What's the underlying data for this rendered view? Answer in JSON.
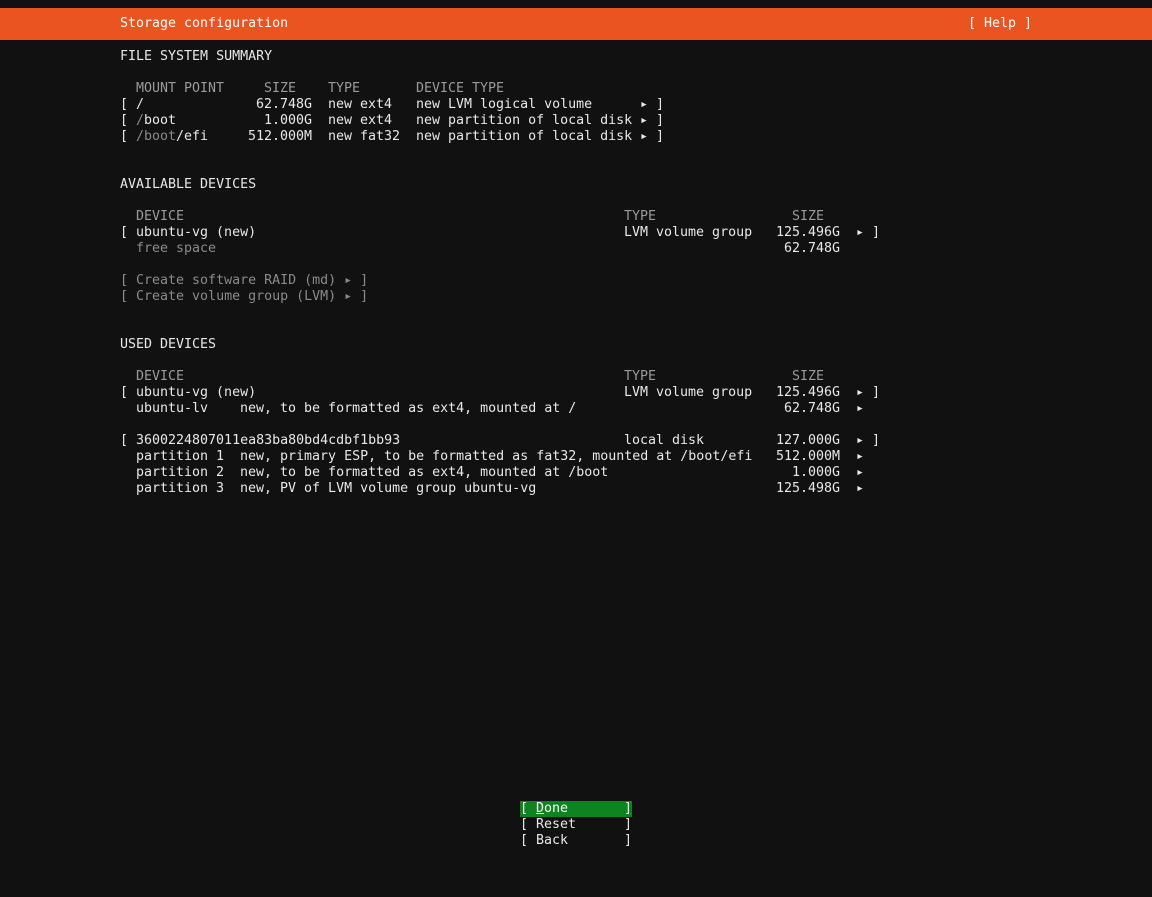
{
  "header": {
    "title": "Storage configuration",
    "help": "[ Help ]"
  },
  "fs_summary": {
    "section_title": "FILE SYSTEM SUMMARY",
    "col_mount": "MOUNT POINT",
    "col_size": "SIZE",
    "col_type": "TYPE",
    "col_device_type": "DEVICE TYPE",
    "rows": [
      {
        "lb": "[",
        "mount_a": "/",
        "mount_b": "",
        "mount_c": "",
        "size": "62.748G",
        "type": "new ext4",
        "device_type": "new LVM logical volume",
        "arrow": "▸ ]"
      },
      {
        "lb": "[",
        "mount_a": "/",
        "mount_b": "boot",
        "mount_c": "",
        "size": "1.000G",
        "type": "new ext4",
        "device_type": "new partition of local disk",
        "arrow": "▸ ]"
      },
      {
        "lb": "[",
        "mount_a": "/boot",
        "mount_b": "/efi",
        "mount_c": "",
        "size": "512.000M",
        "type": "new fat32",
        "device_type": "new partition of local disk",
        "arrow": "▸ ]"
      }
    ]
  },
  "available": {
    "section_title": "AVAILABLE DEVICES",
    "col_device": "DEVICE",
    "col_type": "TYPE",
    "col_size": "SIZE",
    "vg": {
      "lb": "[",
      "device": "ubuntu-vg (new)",
      "type": "LVM volume group",
      "size": "125.496G",
      "arrow": "▸ ]"
    },
    "free": {
      "label": "free space",
      "size": "62.748G"
    },
    "actions": [
      "[ Create software RAID (md) ▸ ]",
      "[ Create volume group (LVM) ▸ ]"
    ]
  },
  "used": {
    "section_title": "USED DEVICES",
    "col_device": "DEVICE",
    "col_type": "TYPE",
    "col_size": "SIZE",
    "vg": {
      "lb": "[",
      "device": "ubuntu-vg (new)",
      "type": "LVM volume group",
      "size": "125.496G",
      "arrow": "▸ ]"
    },
    "lv": {
      "name": "ubuntu-lv",
      "desc": "new, to be formatted as ext4, mounted at /",
      "size": "62.748G",
      "arrow": "▸"
    },
    "disk": {
      "lb": "[",
      "device": "3600224807011ea83ba80bd4cdbf1bb93",
      "type": "local disk",
      "size": "127.000G",
      "arrow": "▸ ]"
    },
    "partitions": [
      {
        "name": "partition 1",
        "desc": "new, primary ESP, to be formatted as fat32, mounted at /boot/efi",
        "size": "512.000M",
        "arrow": "▸"
      },
      {
        "name": "partition 2",
        "desc": "new, to be formatted as ext4, mounted at /boot",
        "size": "1.000G",
        "arrow": "▸"
      },
      {
        "name": "partition 3",
        "desc": "new, PV of LVM volume group ubuntu-vg",
        "size": "125.498G",
        "arrow": "▸"
      }
    ]
  },
  "buttons": {
    "lb": "[",
    "rb": "]",
    "done_first": "D",
    "done_rest": "one",
    "reset": "Reset",
    "back": "Back"
  },
  "colors": {
    "header_bg": "#e95420",
    "focus_bg": "#0e8420",
    "background": "#111111"
  }
}
